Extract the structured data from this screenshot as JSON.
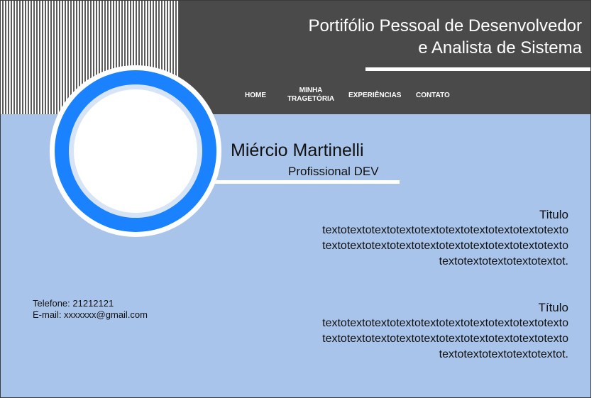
{
  "header": {
    "title_line1": "Portifólio Pessoal de Desenvolvedor",
    "title_line2": "e Analista de Sistema"
  },
  "nav": {
    "home": "HOME",
    "trajetoria_line1": "MINHA",
    "trajetoria_line2": "TRAGETÓRIA",
    "experiencias": "EXPERIÊNCIAS",
    "contato": "CONTATO"
  },
  "profile": {
    "name": "Miércio Martinelli",
    "role": "Profissional DEV"
  },
  "contact": {
    "phone": "Telefone: 21212121",
    "email": "E-mail: xxxxxxx@gmail.com"
  },
  "sections": [
    {
      "title": "Titulo",
      "lines": [
        "textotextotextotextotextotextotextotextotextotexto",
        "textotextotextotextotextotextotextotextotextotexto",
        "textotextotextotextotextot."
      ]
    },
    {
      "title": "Título",
      "lines": [
        "textotextotextotextotextotextotextotextotextotexto",
        "textotextotextotextotextotextotextotextotextotexto",
        "textotextotextotextotextot."
      ]
    }
  ],
  "colors": {
    "header_bg": "#4a4a4a",
    "body_bg": "#a9c4ea",
    "accent_blue": "#1a82ff"
  }
}
